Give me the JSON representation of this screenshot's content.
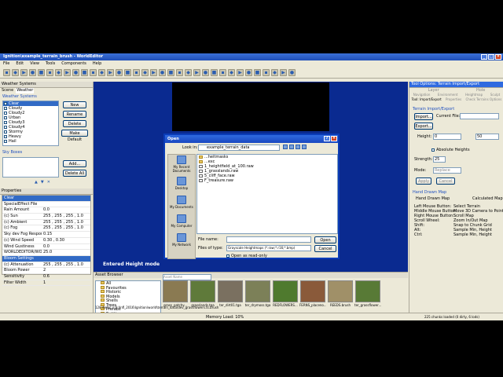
{
  "window": {
    "title": "Ignition\\example_terrain_brush - WorldEditor"
  },
  "menu": [
    "File",
    "Edit",
    "View",
    "Tools",
    "Components",
    "Help"
  ],
  "left": {
    "panel_title": "Weather Systems",
    "tabs": [
      "Scene",
      "Weather"
    ],
    "section_title": "Weather Systems",
    "weather_items": [
      "Clear",
      "Cloudy",
      "Cloudy2",
      "Urban",
      "Cloudy3",
      "Cloudy4",
      "Stormy",
      "Heavy",
      "Hail"
    ],
    "buttons": {
      "new": "New",
      "rename": "Rename",
      "delete": "Delete",
      "make_default": "Make Default",
      "add": "Add...",
      "delete_all": "Delete All"
    },
    "sky_boxes_title": "Sky Boxes",
    "properties_title": "Properties",
    "props": [
      {
        "k": "Clear",
        "v": "",
        "sel": true
      },
      {
        "k": "SpecialEffect File",
        "v": "",
        "sel": false
      },
      {
        "k": "Rain Amount",
        "v": "0.0",
        "sel": false
      },
      {
        "k": "(c) Sun",
        "v": "255 , 255 , 255 , 1.0",
        "sel": false
      },
      {
        "k": "(c) Ambient",
        "v": "255 , 255 , 255 , 1.0",
        "sel": false
      },
      {
        "k": "(c) Fog",
        "v": "255 , 255 , 255 , 1.0",
        "sel": false
      },
      {
        "k": "Sky dev Fog Response",
        "v": "0.15",
        "sel": false
      },
      {
        "k": "(c) Wind Speed",
        "v": "0.30 , 0.30",
        "sel": false
      },
      {
        "k": "Wind Gustiness",
        "v": "0.0",
        "sel": false
      },
      {
        "k": "WORLDEDITOR/WORLD",
        "v": "25.0",
        "sel": false
      },
      {
        "k": "Bloom Settings",
        "v": "",
        "sel": true
      },
      {
        "k": "(c) Attenuation",
        "v": "255 , 255 , 255 , 1.0",
        "sel": false
      },
      {
        "k": "Bloom Power",
        "v": "2",
        "sel": false
      },
      {
        "k": "Sensitivity",
        "v": "0.6",
        "sel": false
      },
      {
        "k": "Filter Width",
        "v": "1",
        "sel": false
      }
    ]
  },
  "viewport": {
    "status": "Entered Height mode"
  },
  "assets": {
    "title": "Asset Browser",
    "search_placeholder": "Asset Name",
    "tree": [
      "All",
      "Favourites",
      "Historic",
      "Models",
      "Shells",
      "Trees",
      "Prefabs",
      "Entities"
    ],
    "thumbs": [
      {
        "label": "grass_patchy...",
        "color": "#8a7a52"
      },
      {
        "label": "grasslands.tga",
        "color": "#5f7a3a"
      },
      {
        "label": "ter_dirt01.tga",
        "color": "#7a7060"
      },
      {
        "label": "ter_drymoss.tga",
        "color": "#7c8058"
      },
      {
        "label": "REDFLOWERS...",
        "color": "#4f7a2e"
      },
      {
        "label": "FERNS_placeno...",
        "color": "#8a5a3a"
      },
      {
        "label": "REEDS.brush",
        "color": "#a09068"
      },
      {
        "label": "ter_grassflower...",
        "color": "#587a36"
      }
    ],
    "path": "128 items :: D:\\Infl_2016\\Ignition\\world\\terrain_data\\dev_grassflowers.ts.brush"
  },
  "right": {
    "panel_title": "Tool Options: Terrain Import/Export",
    "tabs_row1": [
      "Layer",
      "Hole"
    ],
    "tabs_row2": [
      "Navigation",
      "Environment",
      "Heightmap",
      "Sculpt"
    ],
    "tabs_row3": [
      "Tool: Import/Export",
      "Properties",
      "Check Terrains Options"
    ],
    "section": "Terrain Import/Export",
    "import_label": "Import...",
    "export_label": "Export...",
    "current_file_label": "Current File:",
    "height_label": "Height:",
    "height_value": "0",
    "height_max": "50",
    "absolute_label": "Absolute Heights",
    "strength_label": "Strength:",
    "strength_value": "25",
    "mode_label": "Mode:",
    "mode_value": "Replace",
    "apply_label": "Apply",
    "cancel_label": "Cancel",
    "handdrawn_title": "Hand Drawn Map",
    "handdrawn_left": "Hand Drawn Map",
    "handdrawn_right": "Calculated Map",
    "help": [
      [
        "Left Mouse Button:",
        "Select Terrain"
      ],
      [
        "Middle Mouse Button:",
        "Move 3D Camera to Point"
      ],
      [
        "Right Mouse Button:",
        "Scroll Map"
      ],
      [
        "Scroll Wheel:",
        "Zoom In/Out Map"
      ],
      [
        "Shift:",
        "Snap to Chunk Grid"
      ],
      [
        "Alt:",
        "Sample Min, Height"
      ],
      [
        "Ctrl:",
        "Sample Min, Height"
      ]
    ]
  },
  "status": {
    "memory": "Memory Load: 10%",
    "chunks": "225 chunks loaded (0 dirty, 6 lods)"
  },
  "dialog": {
    "title": "Open",
    "look_in_label": "Look in:",
    "look_in_value": "example_terrain_data",
    "places": [
      "My Recent Documents",
      "Desktop",
      "My Documents",
      "My Computer",
      "My Network"
    ],
    "files": [
      {
        "name": "...heitmasks",
        "type": "folder"
      },
      {
        "name": "...exc",
        "type": "folder"
      },
      {
        "name": "1_heightfield_at_100.raw",
        "type": "file"
      },
      {
        "name": "1_grasslands.raw",
        "type": "file"
      },
      {
        "name": "5_cliff_face.raw",
        "type": "file"
      },
      {
        "name": "F_treasure.raw",
        "type": "file"
      }
    ],
    "file_name_label": "File name:",
    "file_name_value": "",
    "file_type_label": "Files of type:",
    "file_type_value": "Grayscale Heightmaps (*.raw;*.r16;*.bmp)",
    "readonly_label": "Open as read-only",
    "open_label": "Open",
    "cancel_label": "Cancel"
  }
}
